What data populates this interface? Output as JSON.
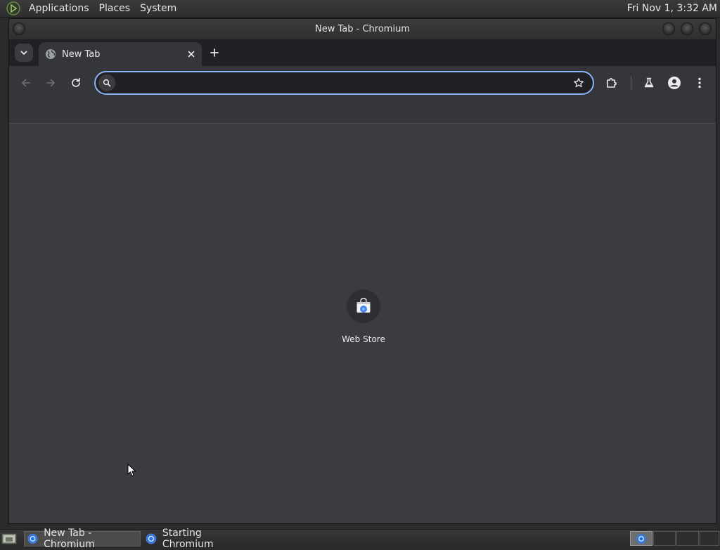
{
  "top_panel": {
    "menus": [
      "Applications",
      "Places",
      "System"
    ],
    "clock": "Fri Nov 1,  3:32 AM"
  },
  "window": {
    "title": "New Tab - Chromium"
  },
  "tabs": [
    {
      "title": "New Tab",
      "icon": "globe-icon",
      "active": true
    }
  ],
  "omnibox": {
    "value": "",
    "placeholder": ""
  },
  "shortcuts": [
    {
      "label": "Web Store",
      "icon": "web-store-icon"
    }
  ],
  "taskbar": {
    "tasks": [
      {
        "label": "New Tab - Chromium",
        "active": true
      },
      {
        "label": "Starting Chromium",
        "active": false
      }
    ]
  },
  "colors": {
    "accent": "#8ab4f8",
    "content_bg": "#3c3c40",
    "toolbar_bg": "#35363a",
    "tabstrip_bg": "#202124"
  }
}
